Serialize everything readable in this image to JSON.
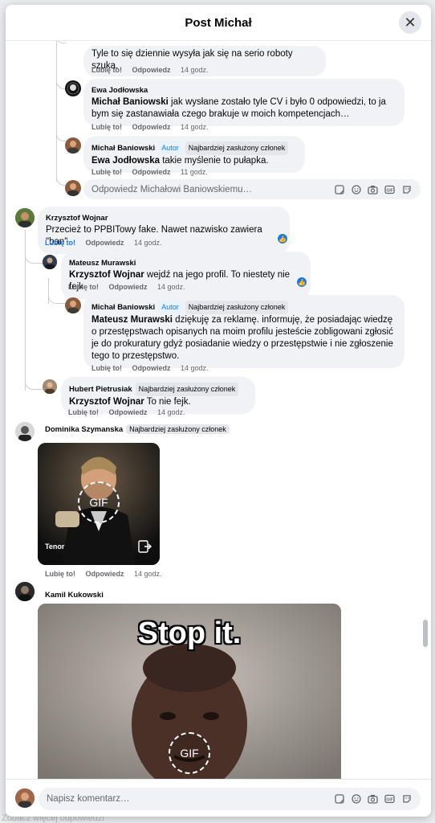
{
  "window": {
    "title": "Post Michał"
  },
  "background": {
    "partial_text": "Zobacz więcej odpowiedzi"
  },
  "labels": {
    "like": "Lubię to!",
    "reply": "Odpowiedz"
  },
  "badges": {
    "author": "Autor",
    "top_fan": "Najbardziej zasłużony członek"
  },
  "comments": [
    {
      "text": "Tyle to się dziennie wysyła jak się na serio roboty szuka.",
      "time": "14 godz."
    },
    {
      "author": "Ewa Jodłowska",
      "mention": "Michał Baniowski",
      "text": " jak wysłane zostało tyle CV i było 0 odpowiedzi, to ja bym się zastanawiała czego brakuje w moich kompetencjach…",
      "time": "14 godz."
    },
    {
      "author": "Michał Baniowski",
      "mention": "Ewa Jodłowska",
      "text": " takie myślenie to pułapka.",
      "time": "11 godz."
    },
    {
      "author": "Krzysztof Wojnar",
      "text": "Przecież to PPBITowy fake. Nawet nazwisko zawiera \"ban\"",
      "time": "14 godz."
    },
    {
      "author": "Mateusz Murawski",
      "mention": "Krzysztof Wojnar",
      "text": " wejdź na jego profil. To niestety nie fejk",
      "time": "14 godz."
    },
    {
      "author": "Michał Baniowski",
      "mention": "Mateusz Murawski",
      "text": " dziękuję za reklamę. informuję, że posiadając wiedzę o przestępstwach opisanych na moim profilu jesteście zobligowani zgłosić je do prokuratury gdyż posiadanie wiedzy o przestępstwie i nie zgłoszenie tego to przestępstwo.",
      "time": "14 godz."
    },
    {
      "author": "Hubert Pietrusiak",
      "mention": "Krzysztof Wojnar",
      "text": " To nie fejk.",
      "time": "14 godz."
    },
    {
      "author": "Dominika Szymanska",
      "gif_source": "Tenor",
      "gif_label": "GIF",
      "time": "14 godz."
    },
    {
      "author": "Kamil Kukowski",
      "gif_caption": "Stop it.",
      "gif_label": "GIF"
    }
  ],
  "reply_box": {
    "placeholder": "Odpowiedz Michałowi Baniowskiemu…"
  },
  "comment_box": {
    "placeholder": "Napisz komentarz…"
  },
  "colors": {
    "accent": "#1877f2",
    "bubble": "#f0f2f5",
    "meta": "#65676b"
  },
  "icons": [
    "close-icon",
    "sticker-icon",
    "emoji-icon",
    "camera-icon",
    "gif-icon",
    "avatar-sticker-icon",
    "like-reaction-icon",
    "share-icon"
  ]
}
